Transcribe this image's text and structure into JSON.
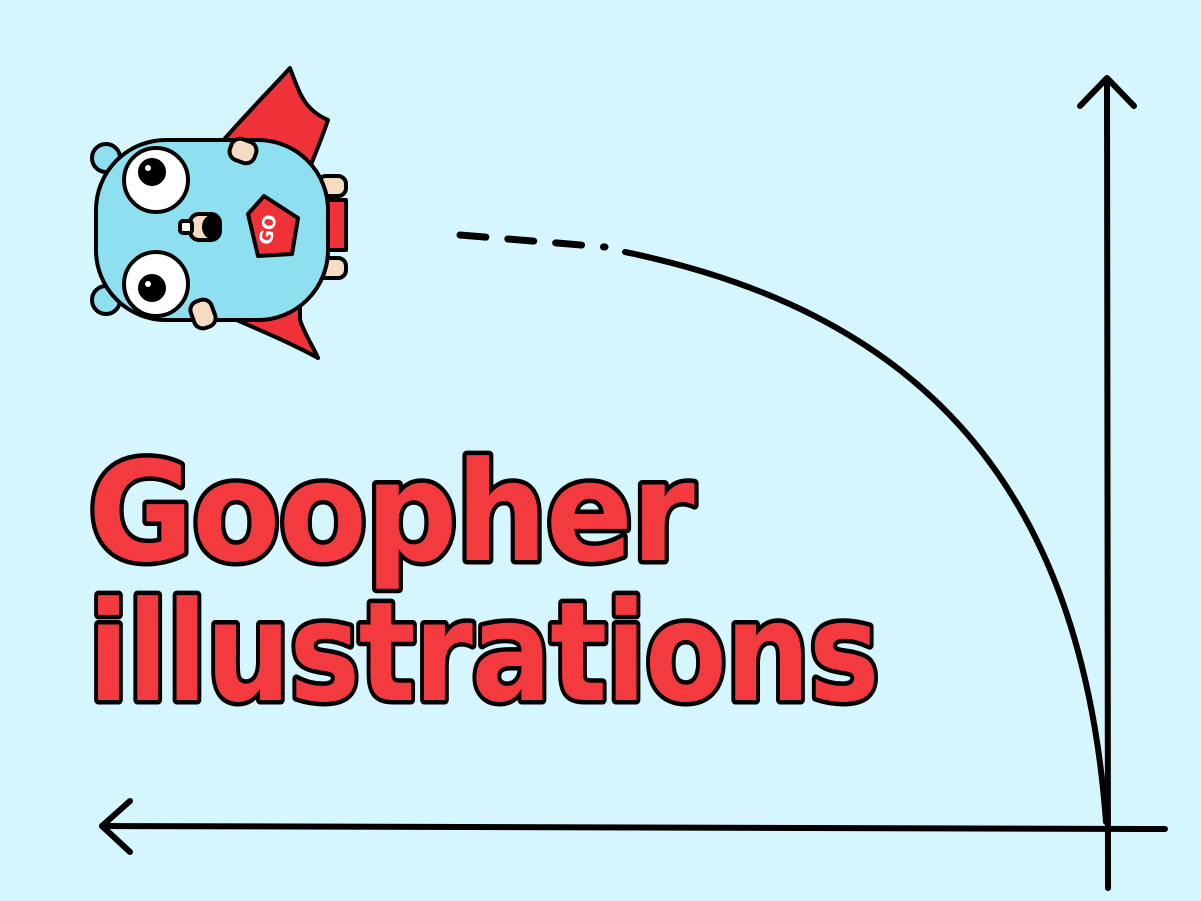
{
  "slide": {
    "title_line_1": "Goopher",
    "title_line_2": "illustrations",
    "badge_text": "GO"
  },
  "colors": {
    "background": "#d6f6fd",
    "title_fill": "#f23a3f",
    "outline": "#000000",
    "gopher_body": "#8ee0f1",
    "cape": "#ee3238",
    "gopher_skin": "#f3dcc1"
  },
  "icons": {
    "gopher": "superhero-gopher-icon",
    "x_axis": "arrow-left-icon",
    "y_axis": "arrow-up-icon"
  }
}
